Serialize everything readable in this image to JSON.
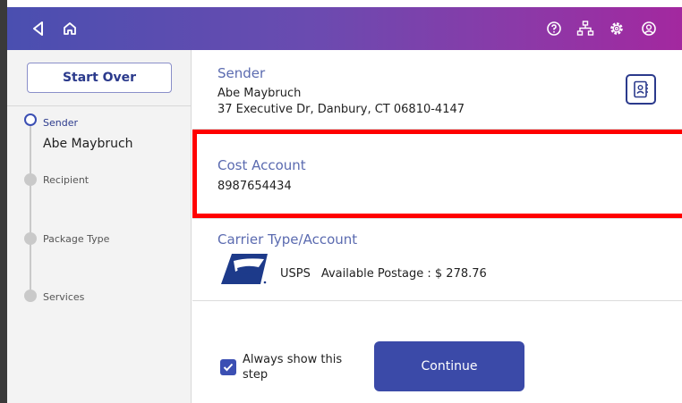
{
  "topbar": {
    "icons": [
      "back-arrow-icon",
      "home-icon",
      "help-icon",
      "network-icon",
      "settings-gear-icon",
      "account-icon"
    ]
  },
  "sidebar": {
    "start_over_label": "Start Over",
    "steps": [
      {
        "label": "Sender",
        "value": "Abe Maybruch",
        "active": true
      },
      {
        "label": "Recipient",
        "value": "",
        "active": false
      },
      {
        "label": "Package Type",
        "value": "",
        "active": false
      },
      {
        "label": "Services",
        "value": "",
        "active": false
      }
    ]
  },
  "main": {
    "sender": {
      "title": "Sender",
      "name": "Abe Maybruch",
      "address": "37 Executive Dr, Danbury, CT 06810-4147"
    },
    "cost_account": {
      "title": "Cost Account",
      "value": "8987654434"
    },
    "carrier": {
      "title": "Carrier Type/Account",
      "carrier_name": "USPS",
      "postage_label": "Available Postage : $ 278.76"
    },
    "always_show_label": "Always show this step",
    "always_show_checked": true,
    "continue_label": "Continue"
  },
  "colors": {
    "accent": "#3b4aa8",
    "highlight": "#ff0000",
    "section_title": "#5b6bb0"
  }
}
